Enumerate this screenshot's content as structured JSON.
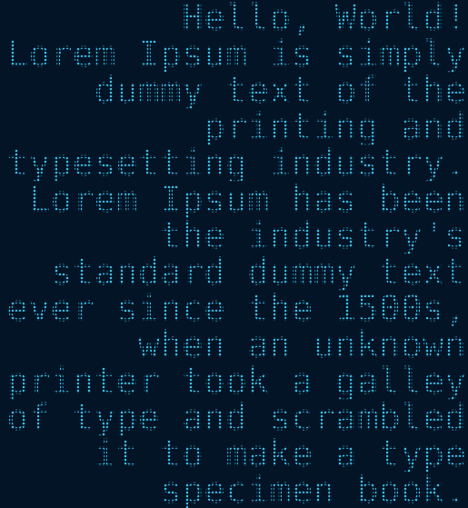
{
  "display": {
    "text_color": "#3bbfe8",
    "background_color": "#031426",
    "lines": [
      "Hello, World!",
      "Lorem Ipsum is simply",
      "dummy text of the",
      "printing and",
      "typesetting industry.",
      "Lorem Ipsum has been",
      "the industry's",
      "standard dummy text",
      "ever since the 1500s,",
      "when an unknown",
      "printer took a galley",
      "of type and scrambled",
      "it to make a type",
      "specimen book."
    ]
  }
}
